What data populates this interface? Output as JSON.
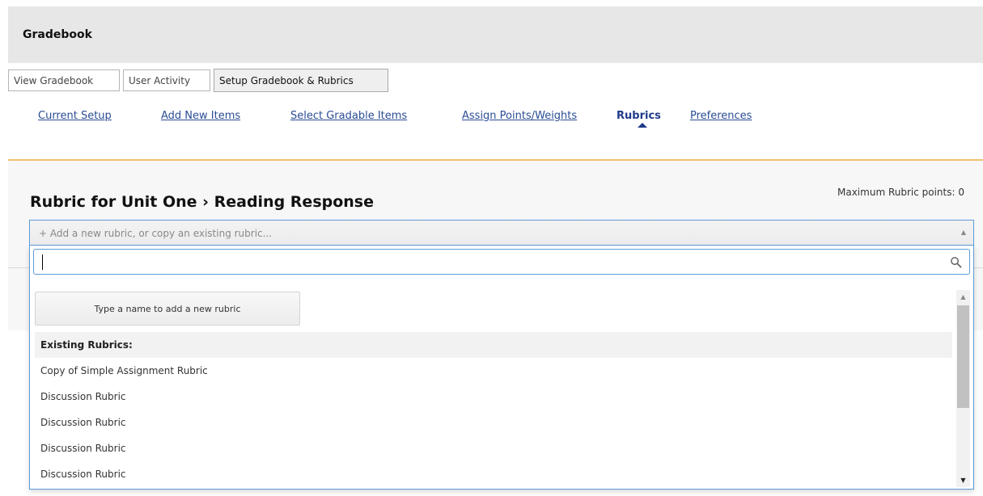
{
  "header": {
    "title": "Gradebook"
  },
  "view_tabs": [
    {
      "label": "View Gradebook",
      "active": false
    },
    {
      "label": "User Activity",
      "active": false
    },
    {
      "label": "Setup Gradebook & Rubrics",
      "active": true
    }
  ],
  "subnav": [
    {
      "label": "Current Setup",
      "active": false
    },
    {
      "label": "Add New Items",
      "active": false
    },
    {
      "label": "Select Gradable Items",
      "active": false
    },
    {
      "label": "Assign Points/Weights",
      "active": false
    },
    {
      "label": "Rubrics",
      "active": true
    },
    {
      "label": "Preferences",
      "active": false
    }
  ],
  "rubric": {
    "title": "Rubric for Unit One › Reading Response",
    "max_points": "Maximum Rubric points: 0"
  },
  "select": {
    "placeholder": "+ Add a new rubric, or copy an existing rubric..."
  },
  "dropdown": {
    "search_value": "",
    "add_button_label": "Type a name to add a new rubric",
    "list_header": "Existing Rubrics:",
    "items": [
      "Copy of Simple Assignment Rubric",
      "Discussion Rubric",
      "Discussion Rubric",
      "Discussion Rubric",
      "Discussion Rubric"
    ]
  },
  "colors": {
    "accent": "#5b9bd5",
    "link": "#2a4c94",
    "panel_border": "#f0c26b"
  },
  "icons": {
    "search": "search-icon",
    "select_arrow": "triangle-up-icon",
    "scroll_up": "scroll-up-icon",
    "scroll_down": "scroll-down-icon"
  }
}
